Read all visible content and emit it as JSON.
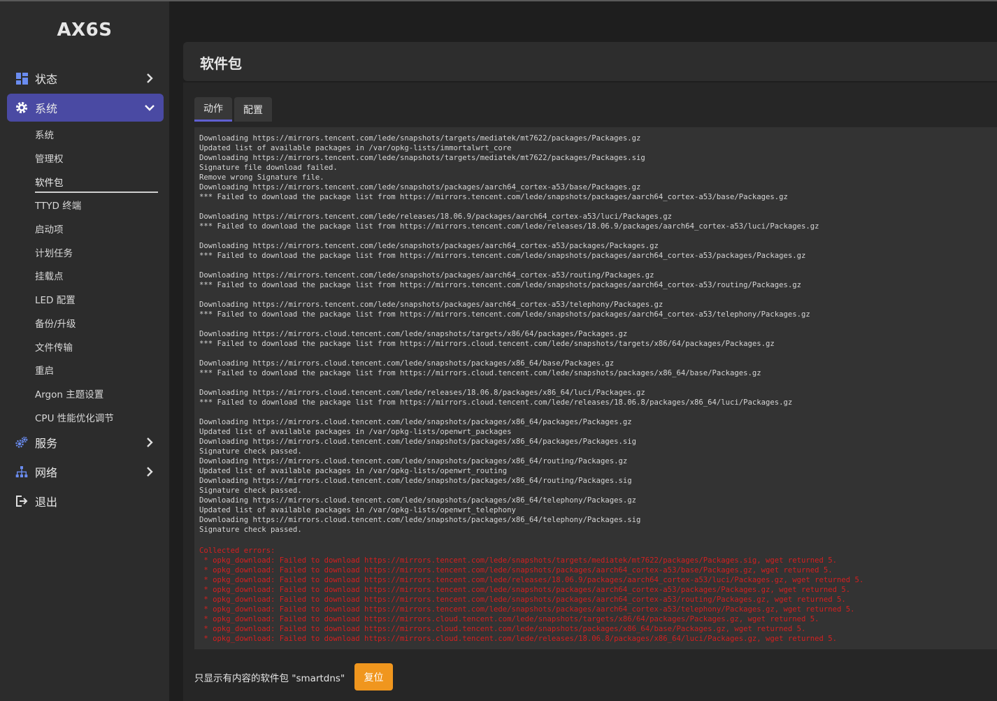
{
  "brand": "AX6S",
  "colors": {
    "active_menu": "#4a4aa3",
    "accent_tab": "#5f5fd0",
    "reset_button": "#f0961e",
    "error_text": "#d42020"
  },
  "sidebar": {
    "status": {
      "label": "状态",
      "icon": "dashboard-icon"
    },
    "system": {
      "label": "系统",
      "icon": "gear-icon"
    },
    "sub": [
      "系统",
      "管理权",
      "软件包",
      "TTYD 终端",
      "启动项",
      "计划任务",
      "挂载点",
      "LED 配置",
      "备份/升级",
      "文件传输",
      "重启",
      "Argon 主题设置",
      "CPU 性能优化调节"
    ],
    "services": {
      "label": "服务",
      "icon": "cogs-icon"
    },
    "network": {
      "label": "网络",
      "icon": "network-icon"
    },
    "logout": {
      "label": "退出",
      "icon": "logout-icon"
    }
  },
  "page": {
    "title": "软件包",
    "tabs": [
      "动作",
      "配置"
    ],
    "log": "Downloading https://mirrors.tencent.com/lede/snapshots/targets/mediatek/mt7622/packages/Packages.gz\nUpdated list of available packages in /var/opkg-lists/immortalwrt_core\nDownloading https://mirrors.tencent.com/lede/snapshots/targets/mediatek/mt7622/packages/Packages.sig\nSignature file download failed.\nRemove wrong Signature file.\nDownloading https://mirrors.tencent.com/lede/snapshots/packages/aarch64_cortex-a53/base/Packages.gz\n*** Failed to download the package list from https://mirrors.tencent.com/lede/snapshots/packages/aarch64_cortex-a53/base/Packages.gz\n\nDownloading https://mirrors.tencent.com/lede/releases/18.06.9/packages/aarch64_cortex-a53/luci/Packages.gz\n*** Failed to download the package list from https://mirrors.tencent.com/lede/releases/18.06.9/packages/aarch64_cortex-a53/luci/Packages.gz\n\nDownloading https://mirrors.tencent.com/lede/snapshots/packages/aarch64_cortex-a53/packages/Packages.gz\n*** Failed to download the package list from https://mirrors.tencent.com/lede/snapshots/packages/aarch64_cortex-a53/packages/Packages.gz\n\nDownloading https://mirrors.tencent.com/lede/snapshots/packages/aarch64_cortex-a53/routing/Packages.gz\n*** Failed to download the package list from https://mirrors.tencent.com/lede/snapshots/packages/aarch64_cortex-a53/routing/Packages.gz\n\nDownloading https://mirrors.tencent.com/lede/snapshots/packages/aarch64_cortex-a53/telephony/Packages.gz\n*** Failed to download the package list from https://mirrors.tencent.com/lede/snapshots/packages/aarch64_cortex-a53/telephony/Packages.gz\n\nDownloading https://mirrors.cloud.tencent.com/lede/snapshots/targets/x86/64/packages/Packages.gz\n*** Failed to download the package list from https://mirrors.cloud.tencent.com/lede/snapshots/targets/x86/64/packages/Packages.gz\n\nDownloading https://mirrors.cloud.tencent.com/lede/snapshots/packages/x86_64/base/Packages.gz\n*** Failed to download the package list from https://mirrors.cloud.tencent.com/lede/snapshots/packages/x86_64/base/Packages.gz\n\nDownloading https://mirrors.cloud.tencent.com/lede/releases/18.06.8/packages/x86_64/luci/Packages.gz\n*** Failed to download the package list from https://mirrors.cloud.tencent.com/lede/releases/18.06.8/packages/x86_64/luci/Packages.gz\n\nDownloading https://mirrors.cloud.tencent.com/lede/snapshots/packages/x86_64/packages/Packages.gz\nUpdated list of available packages in /var/opkg-lists/openwrt_packages\nDownloading https://mirrors.cloud.tencent.com/lede/snapshots/packages/x86_64/packages/Packages.sig\nSignature check passed.\nDownloading https://mirrors.cloud.tencent.com/lede/snapshots/packages/x86_64/routing/Packages.gz\nUpdated list of available packages in /var/opkg-lists/openwrt_routing\nDownloading https://mirrors.cloud.tencent.com/lede/snapshots/packages/x86_64/routing/Packages.sig\nSignature check passed.\nDownloading https://mirrors.cloud.tencent.com/lede/snapshots/packages/x86_64/telephony/Packages.gz\nUpdated list of available packages in /var/opkg-lists/openwrt_telephony\nDownloading https://mirrors.cloud.tencent.com/lede/snapshots/packages/x86_64/telephony/Packages.sig\nSignature check passed.",
    "errors": "Collected errors:\n * opkg_download: Failed to download https://mirrors.tencent.com/lede/snapshots/targets/mediatek/mt7622/packages/Packages.sig, wget returned 5.\n * opkg_download: Failed to download https://mirrors.tencent.com/lede/snapshots/packages/aarch64_cortex-a53/base/Packages.gz, wget returned 5.\n * opkg_download: Failed to download https://mirrors.tencent.com/lede/releases/18.06.9/packages/aarch64_cortex-a53/luci/Packages.gz, wget returned 5.\n * opkg_download: Failed to download https://mirrors.tencent.com/lede/snapshots/packages/aarch64_cortex-a53/packages/Packages.gz, wget returned 5.\n * opkg_download: Failed to download https://mirrors.tencent.com/lede/snapshots/packages/aarch64_cortex-a53/routing/Packages.gz, wget returned 5.\n * opkg_download: Failed to download https://mirrors.tencent.com/lede/snapshots/packages/aarch64_cortex-a53/telephony/Packages.gz, wget returned 5.\n * opkg_download: Failed to download https://mirrors.cloud.tencent.com/lede/snapshots/targets/x86/64/packages/Packages.gz, wget returned 5.\n * opkg_download: Failed to download https://mirrors.cloud.tencent.com/lede/snapshots/packages/x86_64/base/Packages.gz, wget returned 5.\n * opkg_download: Failed to download https://mirrors.cloud.tencent.com/lede/releases/18.06.8/packages/x86_64/luci/Packages.gz, wget returned 5.",
    "filter_text": "只显示有内容的软件包 \"smartdns\"",
    "reset_label": "复位"
  }
}
